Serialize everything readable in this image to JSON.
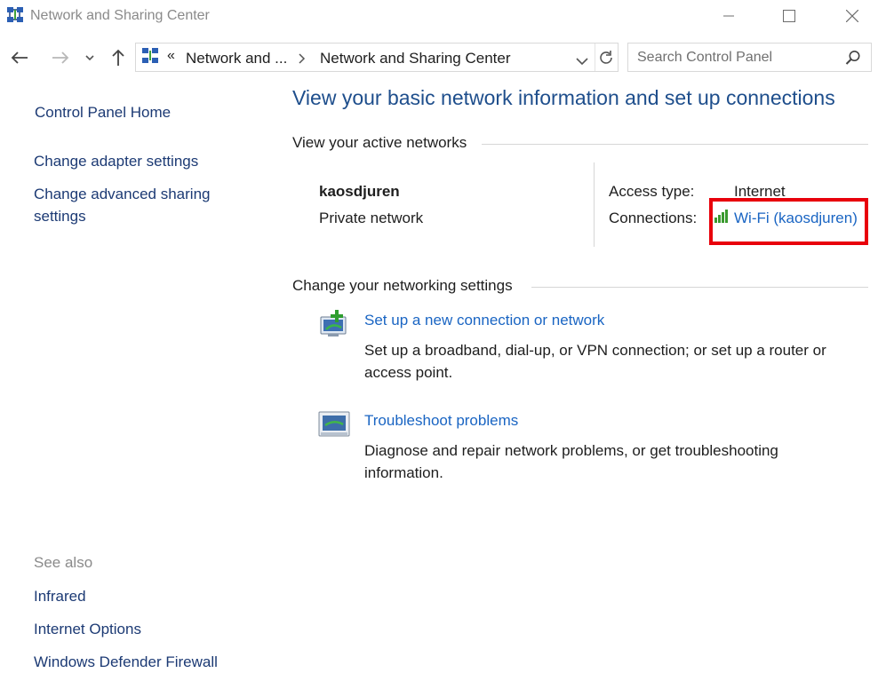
{
  "window": {
    "title": "Network and Sharing Center"
  },
  "nav": {
    "breadcrumb_prefix": "«",
    "breadcrumb_parent": "Network and ...",
    "breadcrumb_current": "Network and Sharing Center",
    "search_placeholder": "Search Control Panel"
  },
  "sidebar": {
    "home": "Control Panel Home",
    "links": [
      "Change adapter settings",
      "Change advanced sharing",
      "settings"
    ],
    "see_also_label": "See also",
    "see_also": [
      "Infrared",
      "Internet Options",
      "Windows Defender Firewall"
    ]
  },
  "main": {
    "heading": "View your basic network information and set up connections",
    "active_label": "View your active networks",
    "network_name": "kaosdjuren",
    "network_type": "Private network",
    "access_type_label": "Access type:",
    "access_type_value": "Internet",
    "connections_label": "Connections:",
    "connection_link": "Wi-Fi (kaosdjuren)",
    "change_label": "Change your networking settings",
    "tasks": [
      {
        "title": "Set up a new connection or network",
        "desc_line1": "Set up a broadband, dial-up, or VPN connection; or set up a router or",
        "desc_line2": "access point."
      },
      {
        "title": "Troubleshoot problems",
        "desc_line1": "Diagnose and repair network problems, or get troubleshooting",
        "desc_line2": "information."
      }
    ]
  },
  "colors": {
    "heading": "#1e4e8c",
    "link": "#1a65c3",
    "highlight": "#e8000b"
  }
}
